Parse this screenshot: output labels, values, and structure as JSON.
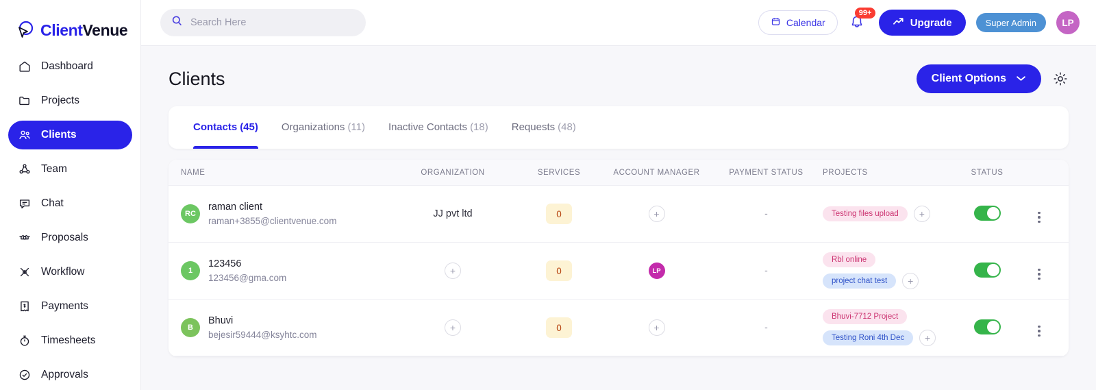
{
  "brand": {
    "name_part1": "Client",
    "name_part2": "Venue",
    "logo_icon": "cursor-bubble-icon"
  },
  "sidebar": {
    "items": [
      {
        "label": "Dashboard",
        "icon": "home-icon",
        "active": false
      },
      {
        "label": "Projects",
        "icon": "folder-icon",
        "active": false
      },
      {
        "label": "Clients",
        "icon": "users-icon",
        "active": true
      },
      {
        "label": "Team",
        "icon": "team-network-icon",
        "active": false
      },
      {
        "label": "Chat",
        "icon": "chat-icon",
        "active": false
      },
      {
        "label": "Proposals",
        "icon": "handshake-icon",
        "active": false
      },
      {
        "label": "Workflow",
        "icon": "workflow-icon",
        "active": false
      },
      {
        "label": "Payments",
        "icon": "payment-receipt-icon",
        "active": false
      },
      {
        "label": "Timesheets",
        "icon": "stopwatch-icon",
        "active": false
      },
      {
        "label": "Approvals",
        "icon": "check-circle-icon",
        "active": false
      }
    ]
  },
  "topbar": {
    "search": {
      "placeholder": "Search Here",
      "value": "",
      "icon": "search-icon"
    },
    "calendar_label": "Calendar",
    "calendar_icon": "calendar-icon",
    "notification_count": "99+",
    "bell_icon": "bell-icon",
    "upgrade_label": "Upgrade",
    "upgrade_icon": "trend-up-icon",
    "role_label": "Super Admin",
    "user_initials": "LP"
  },
  "page": {
    "title": "Clients",
    "client_options_label": "Client Options",
    "client_options_caret": "chevron-down-icon",
    "settings_icon": "gear-icon"
  },
  "tabs": [
    {
      "label": "Contacts",
      "count": "(45)",
      "active": true
    },
    {
      "label": "Organizations",
      "count": "(11)",
      "active": false
    },
    {
      "label": "Inactive Contacts",
      "count": "(18)",
      "active": false
    },
    {
      "label": "Requests",
      "count": "(48)",
      "active": false
    }
  ],
  "table": {
    "columns": [
      "NAME",
      "ORGANIZATION",
      "SERVICES",
      "ACCOUNT MANAGER",
      "PAYMENT STATUS",
      "PROJECTS",
      "STATUS"
    ],
    "rows": [
      {
        "avatar_initials": "RC",
        "avatar_color": "#6cc763",
        "name": "raman client",
        "email": "raman+3855@clientvenue.com",
        "organization": "JJ pvt ltd",
        "organization_has_add": false,
        "services": "0",
        "account_manager": null,
        "account_manager_has_add": true,
        "payment_status": "-",
        "projects": [
          {
            "label": "Testing files upload",
            "color": "pink"
          }
        ],
        "projects_has_add": true,
        "status_on": true
      },
      {
        "avatar_initials": "1",
        "avatar_color": "#6cc763",
        "name": "123456",
        "email": "123456@gma.com",
        "organization": null,
        "organization_has_add": true,
        "services": "0",
        "account_manager": "LP",
        "account_manager_has_add": false,
        "payment_status": "-",
        "projects": [
          {
            "label": "Rbl online",
            "color": "pink"
          },
          {
            "label": "project chat test",
            "color": "blue"
          }
        ],
        "projects_has_add": true,
        "status_on": true
      },
      {
        "avatar_initials": "B",
        "avatar_color": "#7cc35c",
        "name": "Bhuvi",
        "email": "bejesir59444@ksyhtc.com",
        "organization": null,
        "organization_has_add": true,
        "services": "0",
        "account_manager": null,
        "account_manager_has_add": true,
        "payment_status": "-",
        "projects": [
          {
            "label": "Bhuvi-7712 Project",
            "color": "pink"
          },
          {
            "label": "Testing Roni 4th Dec",
            "color": "blue"
          }
        ],
        "projects_has_add": true,
        "status_on": true
      }
    ]
  },
  "colors": {
    "accent": "#2a23e8",
    "danger": "#fa3c32",
    "success": "#35b44a",
    "chip_pink_bg": "#fbe3ee",
    "chip_pink_fg": "#cc3572",
    "chip_blue_bg": "#d6e4fb",
    "chip_blue_fg": "#2f52c8"
  }
}
